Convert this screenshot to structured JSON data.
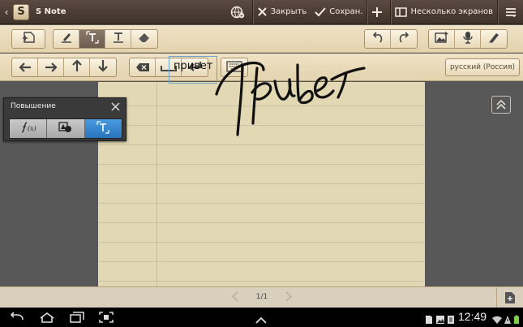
{
  "header": {
    "app_logo_letter": "S",
    "app_title": "S Note",
    "close_label": "Закрыть",
    "save_label": "Сохран.",
    "multiscreen_label": "Несколько экранов"
  },
  "keyboard_bar": {
    "language": "русский (Россия)"
  },
  "panel": {
    "title": "Повышение",
    "tools": [
      "formula",
      "shape",
      "text"
    ],
    "active_tool": "text"
  },
  "note": {
    "recognized_text": "привет"
  },
  "pager": {
    "page_label": "1/1"
  },
  "status": {
    "time": "12:49"
  },
  "colors": {
    "title_bar": "#4d3f36",
    "toolbar_bg": "#e9dab8",
    "paper": "#e2d8b4",
    "active_tool": "#2f80c8",
    "textbox_border": "#6aa4cf"
  }
}
